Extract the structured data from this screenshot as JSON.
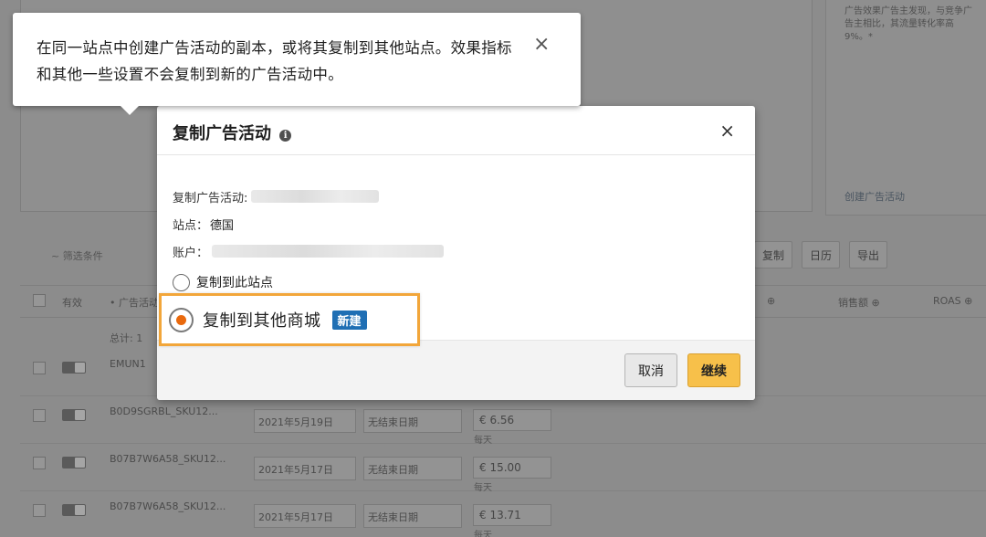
{
  "background": {
    "card_right": {
      "description": "广告效果广告主发现，与竞争广告主相比，其流量转化率高 9%。*",
      "link": "创建广告活动"
    },
    "filter_label": "~ 筛选条件",
    "actions": [
      "复制",
      "日历",
      "导出"
    ],
    "table_headers": {
      "active": "有效",
      "campaign": "• 广告活动",
      "sales_col": "销售额 ⊕",
      "roas_col": "ROAS ⊕",
      "col_a": "⊕"
    },
    "total_row": "总计: 1",
    "rows": [
      {
        "name": "EMUN1",
        "start": "",
        "end": "",
        "budget": "",
        "per_day": ""
      },
      {
        "name": "B0D9SGRBL_SKU12...",
        "start": "2021年5月19日",
        "end": "无结束日期",
        "budget": "€ 6.56",
        "per_day": "每天"
      },
      {
        "name": "B07B7W6A58_SKU12...",
        "start": "2021年5月17日",
        "end": "无结束日期",
        "budget": "€ 15.00",
        "per_day": "每天"
      },
      {
        "name": "B07B7W6A58_SKU12...",
        "start": "2021年5月17日",
        "end": "无结束日期",
        "budget": "€ 13.71",
        "per_day": "每天"
      }
    ]
  },
  "tooltip": {
    "text": "在同一站点中创建广告活动的副本，或将其复制到其他站点。效果指标和其他一些设置不会复制到新的广告活动中。",
    "close_icon": "×"
  },
  "dialog": {
    "title": "复制广告活动",
    "info_icon": "i",
    "close_icon": "×",
    "campaign_label": "复制广告活动:",
    "site_label": "站点：",
    "site_value": "德国",
    "account_label": "账户：",
    "option_this_site": "复制到此站点",
    "option_other": "复制到其他商城",
    "new_badge": "新建",
    "cancel_label": "取消",
    "continue_label": "继续"
  },
  "colors": {
    "accent_orange": "#f2a63a",
    "continue_button": "#f7c04a",
    "badge_blue": "#1f6fb4",
    "radio_selected": "#e9690d"
  }
}
